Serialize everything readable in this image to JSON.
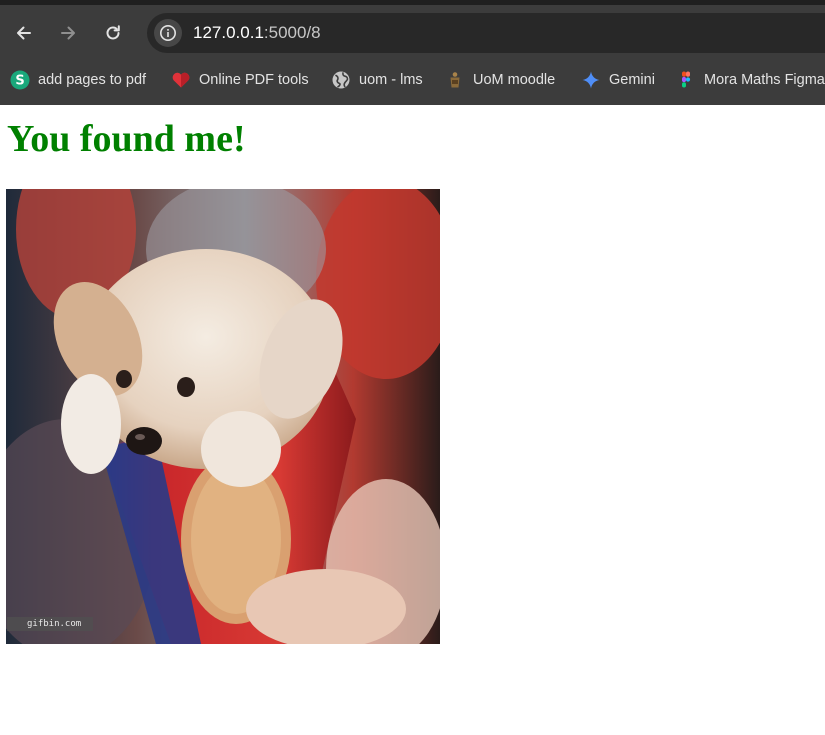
{
  "browser": {
    "url_host": "127.0.0.1",
    "url_rest": ":5000/8",
    "nav": {
      "back_icon": "arrow-left-icon",
      "forward_icon": "arrow-right-icon",
      "reload_icon": "reload-icon",
      "site_info_icon": "info-icon"
    },
    "bookmarks": [
      {
        "label": "add pages to pdf",
        "icon": "s-logo-icon",
        "color": "#1aa87b"
      },
      {
        "label": "Online PDF tools",
        "icon": "heart-pdf-icon",
        "color": "#e0323a"
      },
      {
        "label": "uom - lms",
        "icon": "globe-icon",
        "color": "#c7c7c7"
      },
      {
        "label": "UoM moodle",
        "icon": "crest-icon",
        "color": "#8a6a3a"
      },
      {
        "label": "Gemini",
        "icon": "gemini-sparkle-icon",
        "color": "#4f8ef7"
      },
      {
        "label": "Mora Maths Figma",
        "icon": "figma-icon",
        "color": "#f24e1e"
      }
    ]
  },
  "page": {
    "heading": "You found me!",
    "image_watermark": "gifbin.com",
    "heading_color": "#008000"
  }
}
